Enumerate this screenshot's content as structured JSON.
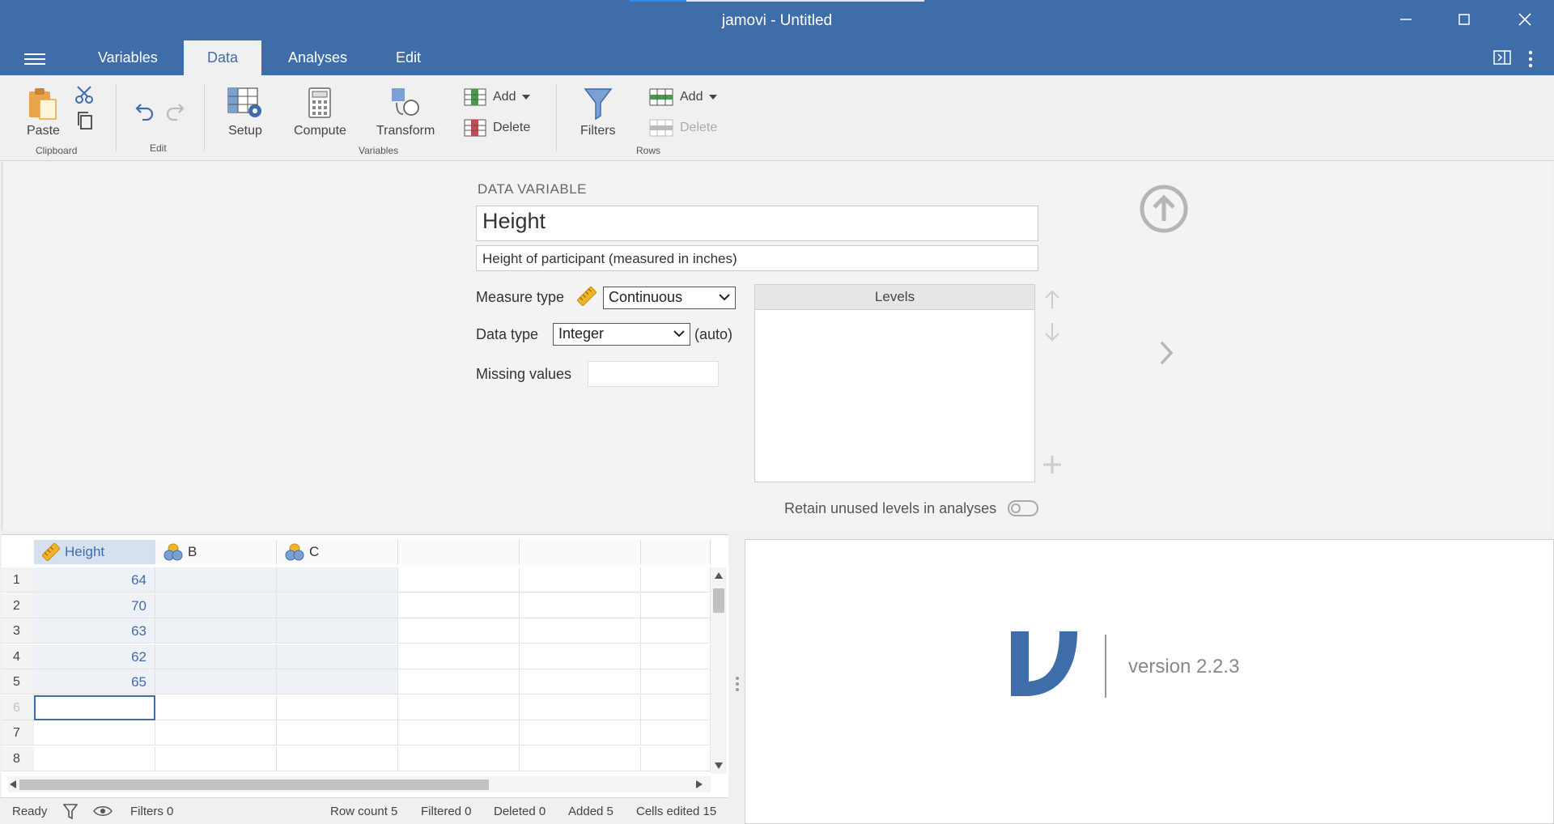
{
  "window": {
    "title": "jamovi - Untitled"
  },
  "tabs": [
    {
      "label": "Variables"
    },
    {
      "label": "Data"
    },
    {
      "label": "Analyses"
    },
    {
      "label": "Edit"
    }
  ],
  "ribbon": {
    "paste": "Paste",
    "clipboard_group": "Clipboard",
    "edit_group": "Edit",
    "setup": "Setup",
    "compute": "Compute",
    "transform": "Transform",
    "var_add": "Add",
    "var_delete": "Delete",
    "variables_group": "Variables",
    "filters": "Filters",
    "row_add": "Add",
    "row_delete": "Delete",
    "rows_group": "Rows"
  },
  "editor": {
    "section_label": "DATA VARIABLE",
    "name": "Height",
    "description": "Height of participant (measured in inches)",
    "measure_type_label": "Measure type",
    "measure_type": "Continuous",
    "data_type_label": "Data type",
    "data_type": "Integer",
    "data_type_auto": "(auto)",
    "missing_values_label": "Missing values",
    "missing_values": "",
    "levels_header": "Levels",
    "retain_label": "Retain unused levels in analyses"
  },
  "grid": {
    "columns": [
      "Height",
      "B",
      "C"
    ],
    "row_numbers": [
      "1",
      "2",
      "3",
      "4",
      "5",
      "6",
      "7",
      "8"
    ],
    "height_values": [
      "64",
      "70",
      "63",
      "62",
      "65"
    ]
  },
  "results": {
    "version": "version 2.2.3"
  },
  "status": {
    "ready": "Ready",
    "filters": "Filters 0",
    "row_count": "Row count 5",
    "filtered": "Filtered 0",
    "deleted": "Deleted 0",
    "added": "Added 5",
    "cells_edited": "Cells edited 15"
  },
  "colors": {
    "brand": "#3e6da9",
    "ribbon_bg": "#f0f0f0"
  }
}
